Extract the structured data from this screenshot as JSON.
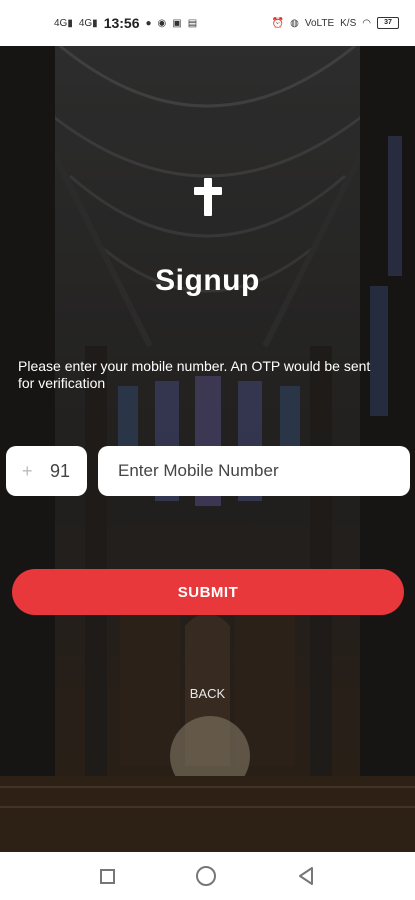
{
  "status_bar": {
    "time": "13:56",
    "left_icons": [
      "4G-signal-icon",
      "4G-signal-icon",
      "whatsapp-icon",
      "compass-icon",
      "gamepad-icon",
      "image-icon"
    ],
    "right_icons": [
      "alarm-icon",
      "vibrate-icon",
      "volte-icon",
      "data-speed-icon",
      "wifi-icon",
      "battery-icon"
    ],
    "net_label_1": "VoLTE",
    "net_label_2": "K/S",
    "battery": "37"
  },
  "page": {
    "title": "Signup",
    "instructions": "Please enter your mobile number. An OTP would be sent for verification",
    "country_code_prefix": "+",
    "country_code": "91",
    "mobile_placeholder": "Enter Mobile Number",
    "mobile_value": "",
    "submit_label": "SUBMIT",
    "back_label": "BACK"
  },
  "colors": {
    "accent": "#e8383b",
    "text_on_dark": "#ffffff"
  },
  "icons": {
    "logo": "cross-icon",
    "nav": [
      "recents-square-icon",
      "home-circle-icon",
      "back-triangle-icon"
    ]
  }
}
